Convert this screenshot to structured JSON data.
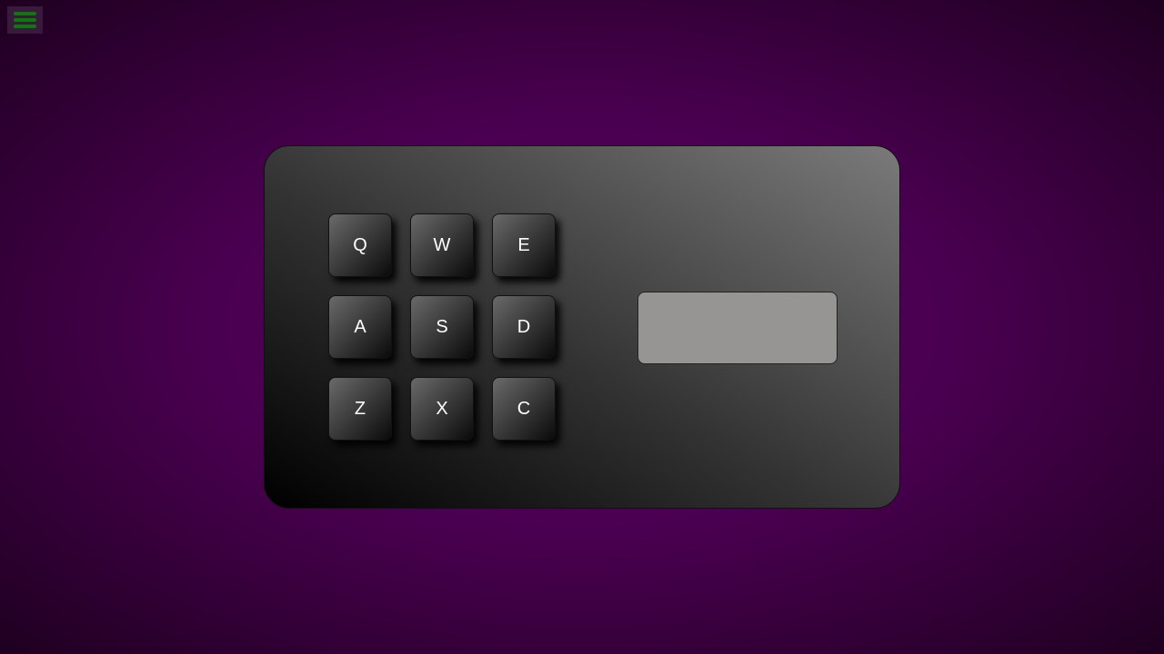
{
  "keys": [
    "Q",
    "W",
    "E",
    "A",
    "S",
    "D",
    "Z",
    "X",
    "C"
  ],
  "display": {
    "value": ""
  }
}
